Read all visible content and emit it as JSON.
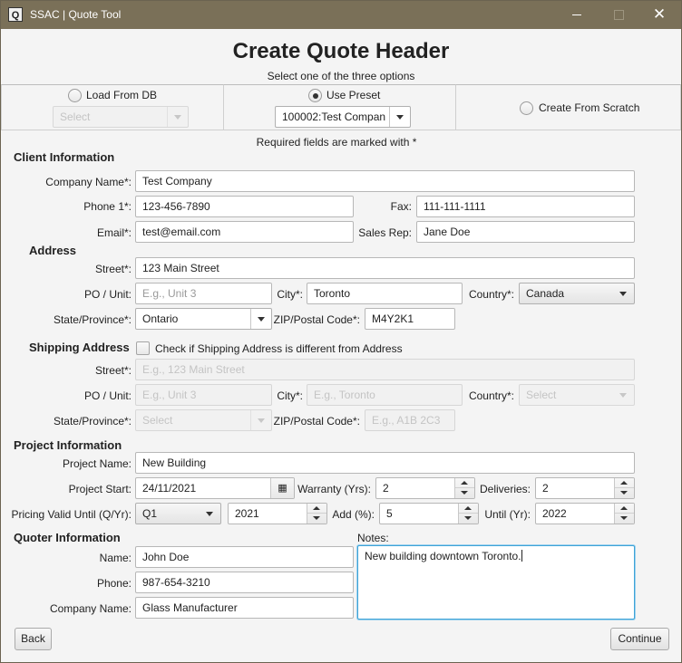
{
  "window": {
    "app_icon": "Q",
    "title": "SSAC | Quote Tool",
    "minimize_glyph": "",
    "maximize_glyph": "",
    "close_glyph": "✕"
  },
  "header": {
    "title": "Create Quote Header",
    "subtitle": "Select one of the three options"
  },
  "options": {
    "load_from_db": {
      "label": "Load From DB",
      "selected": false,
      "select_value": "Select"
    },
    "use_preset": {
      "label": "Use Preset",
      "selected": true,
      "select_value": "100002:Test Compan"
    },
    "create_from_scratch": {
      "label": "Create From Scratch",
      "selected": false
    }
  },
  "required_note": "Required fields are marked with *",
  "client": {
    "section_title": "Client Information",
    "company_name": {
      "label": "Company Name*:",
      "value": "Test Company"
    },
    "phone1": {
      "label": "Phone 1*:",
      "value": "123-456-7890"
    },
    "fax": {
      "label": "Fax:",
      "value": "111-111-1111"
    },
    "email": {
      "label": "Email*:",
      "value": "test@email.com"
    },
    "sales_rep": {
      "label": "Sales Rep:",
      "value": "Jane Doe"
    }
  },
  "address": {
    "section_title": "Address",
    "street": {
      "label": "Street*:",
      "value": "123 Main Street"
    },
    "po_unit": {
      "label": "PO / Unit:",
      "placeholder": "E.g., Unit 3"
    },
    "city": {
      "label": "City*:",
      "value": "Toronto"
    },
    "country": {
      "label": "Country*:",
      "value": "Canada"
    },
    "state": {
      "label": "State/Province*:",
      "value": "Ontario"
    },
    "zip": {
      "label": "ZIP/Postal Code*:",
      "value": "M4Y2K1"
    }
  },
  "shipping": {
    "section_title": "Shipping Address",
    "checkbox_label": "Check if Shipping Address is different from Address",
    "checked": false,
    "street": {
      "label": "Street*:",
      "placeholder": "E.g., 123 Main Street"
    },
    "po_unit": {
      "label": "PO / Unit:",
      "placeholder": "E.g., Unit 3"
    },
    "city": {
      "label": "City*:",
      "placeholder": "E.g., Toronto"
    },
    "country": {
      "label": "Country*:",
      "placeholder": "Select"
    },
    "state": {
      "label": "State/Province*:",
      "placeholder": "Select"
    },
    "zip": {
      "label": "ZIP/Postal Code*:",
      "placeholder": "E.g., A1B 2C3"
    }
  },
  "project": {
    "section_title": "Project Information",
    "name": {
      "label": "Project Name:",
      "value": "New Building"
    },
    "start": {
      "label": "Project Start:",
      "value": "24/11/2021",
      "calendar_glyph": "▦"
    },
    "warranty": {
      "label": "Warranty (Yrs):",
      "value": "2"
    },
    "deliveries": {
      "label": "Deliveries:",
      "value": "2"
    },
    "pricing_valid": {
      "label": "Pricing Valid Until (Q/Yr):",
      "quarter": "Q1",
      "year": "2021"
    },
    "add_pct": {
      "label": "Add (%):",
      "value": "5"
    },
    "until": {
      "label": "Until (Yr):",
      "value": "2022"
    }
  },
  "quoter": {
    "section_title": "Quoter Information",
    "name": {
      "label": "Name:",
      "value": "John Doe"
    },
    "phone": {
      "label": "Phone:",
      "value": "987-654-3210"
    },
    "company": {
      "label": "Company Name:",
      "value": "Glass Manufacturer"
    },
    "notes_label": "Notes:",
    "notes_value": "New building downtown Toronto."
  },
  "footer": {
    "back_label": "Back",
    "continue_label": "Continue"
  }
}
